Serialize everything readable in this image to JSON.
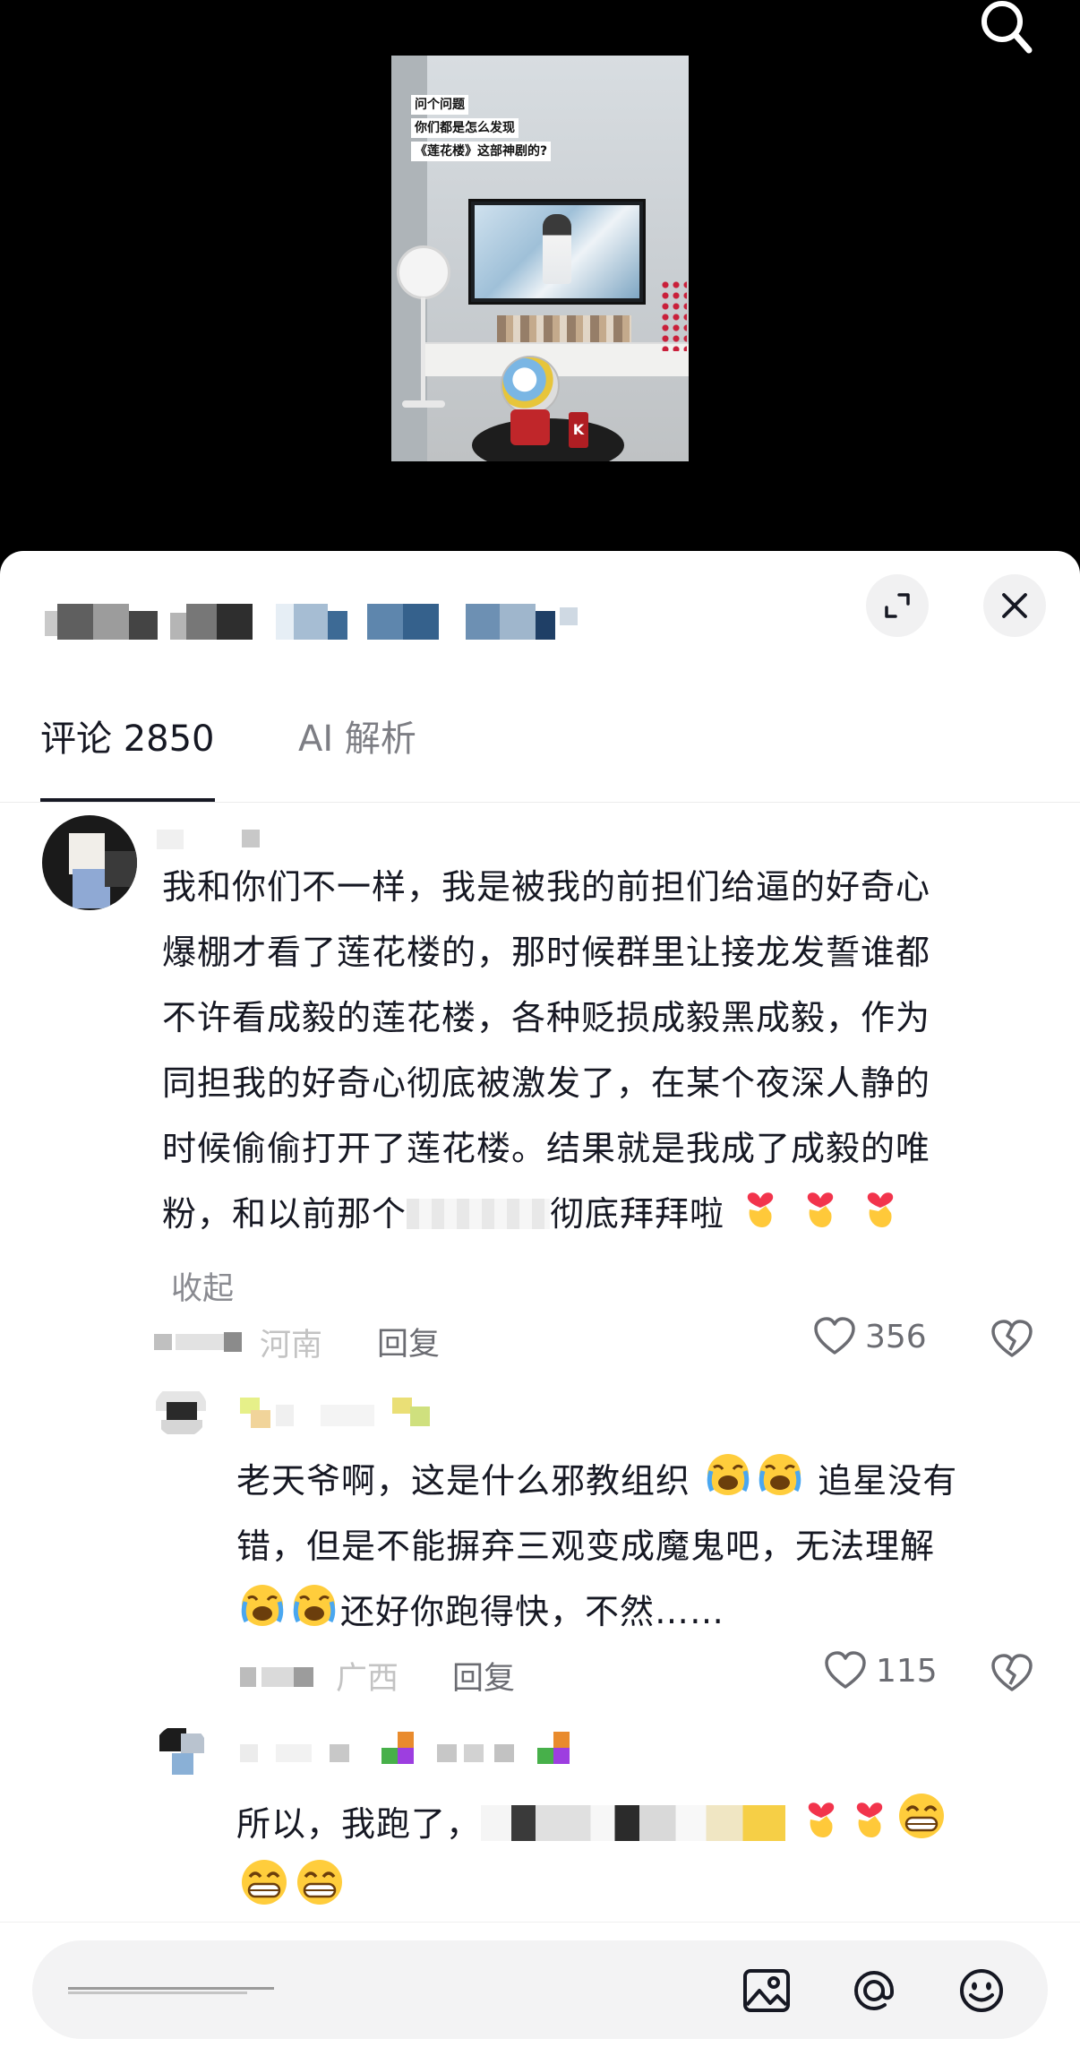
{
  "video": {
    "caption_lines": [
      "问个问题",
      "你们都是怎么发现",
      "《莲花楼》这部神剧的?"
    ],
    "cup_letter": "K"
  },
  "panel": {
    "tabs": [
      {
        "label": "评论 2850",
        "active": true
      },
      {
        "label": "AI 解析",
        "active": false
      }
    ]
  },
  "comments": [
    {
      "text_lines": [
        "我和你们不一样，我是被我的前担们给逼的好奇心",
        "爆棚才看了莲花楼的，那时候群里让接龙发誓谁都",
        "不许看成毅的莲花楼，各种贬损成毅黑成毅，作为",
        "同担我的好奇心彻底被激发了，在某个夜深人静的",
        "时候偷偷打开了莲花楼。结果就是我成了成毅的唯",
        "粉，和以前那个"
      ],
      "text_tail": "彻底拜拜啦",
      "collapse_label": "收起",
      "location": "河南",
      "reply_label": "回复",
      "likes": "356"
    },
    {
      "text_lines": [
        "老天爷啊，这是什么邪教组织",
        "追星没有",
        "错，但是不能摒弃三观变成魔鬼吧，无法理解",
        "还好你跑得快，不然……"
      ],
      "location": "广西",
      "reply_label": "回复",
      "likes": "115"
    },
    {
      "text_start": "所以，我跑了，"
    }
  ],
  "colors": {
    "text": "#161823",
    "secondary": "#8a8b91",
    "heart_emoji": "#f2344c",
    "hand_emoji": "#ffc93a"
  },
  "icons": [
    "search-icon",
    "expand-icon",
    "close-icon",
    "heart-icon",
    "dislike-icon",
    "image-icon",
    "at-icon",
    "emoji-icon"
  ]
}
